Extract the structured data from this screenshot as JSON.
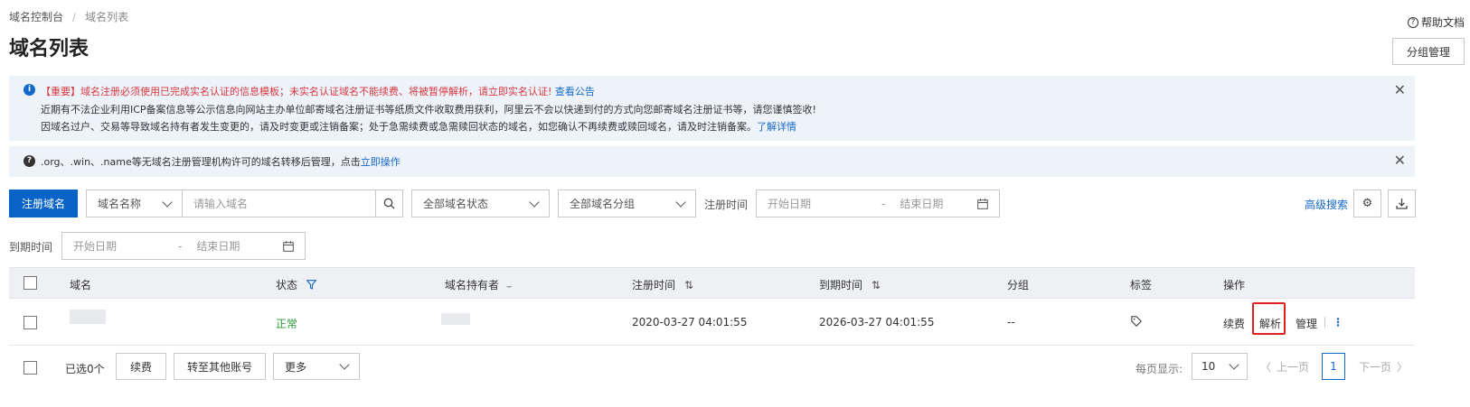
{
  "breadcrumb": {
    "root": "域名控制台",
    "separator": "/",
    "current": "域名列表"
  },
  "help": {
    "label": "帮助文档"
  },
  "page_title": "域名列表",
  "group_manage_label": "分组管理",
  "notice": {
    "important": "【重要】域名注册必须使用已完成实名认证的信息模板；未实名认证域名不能续费、将被暂停解析，请立即实名认证!",
    "important_link": "查看公告",
    "line2": "近期有不法企业利用ICP备案信息等公示信息向网站主办单位邮寄域名注册证书等纸质文件收取费用获利，阿里云不会以快递到付的方式向您邮寄域名注册证书等，请您谨慎签收!",
    "line3": "因域名过户、交易等导致域名持有者发生变更的，请及时变更或注销备案；处于急需续费或急需赎回状态的域名，如您确认不再续费或赎回域名，请及时注销备案。",
    "line3_link": "了解详情",
    "transfer_text": ".org、.win、.name等无域名注册管理机构许可的域名转移后管理，点击",
    "transfer_link": "立即操作"
  },
  "toolbar": {
    "register_label": "注册域名",
    "search_field_select": "域名名称",
    "search_placeholder": "请输入域名",
    "status_select": "全部域名状态",
    "group_select": "全部域名分组",
    "reg_time_label": "注册时间",
    "start_date": "开始日期",
    "date_sep": "-",
    "end_date": "结束日期",
    "advanced_search": "高级搜索",
    "expire_time_label": "到期时间"
  },
  "table": {
    "headers": [
      "域名",
      "状态",
      "域名持有者",
      "注册时间",
      "到期时间",
      "分组",
      "标签",
      "操作"
    ],
    "rows": [
      {
        "status": "正常",
        "reg_time": "2020-03-27 04:01:55",
        "expire_time": "2026-03-27 04:01:55",
        "group": "--",
        "actions": {
          "renew": "续费",
          "resolve": "解析",
          "manage": "管理",
          "more": "⋮"
        }
      }
    ]
  },
  "footer": {
    "selected": "已选0个",
    "renew": "续费",
    "transfer": "转至其他账号",
    "more": "更多",
    "page_size_label": "每页显示:",
    "page_size": "10",
    "prev": "上一页",
    "current_page": "1",
    "next": "下一页"
  },
  "colors": {
    "primary": "#0a64c8",
    "link": "#1468c8",
    "status_ok": "#2e9a3c",
    "highlight": "#e0201e",
    "notice_bg": "#eef3fa"
  }
}
